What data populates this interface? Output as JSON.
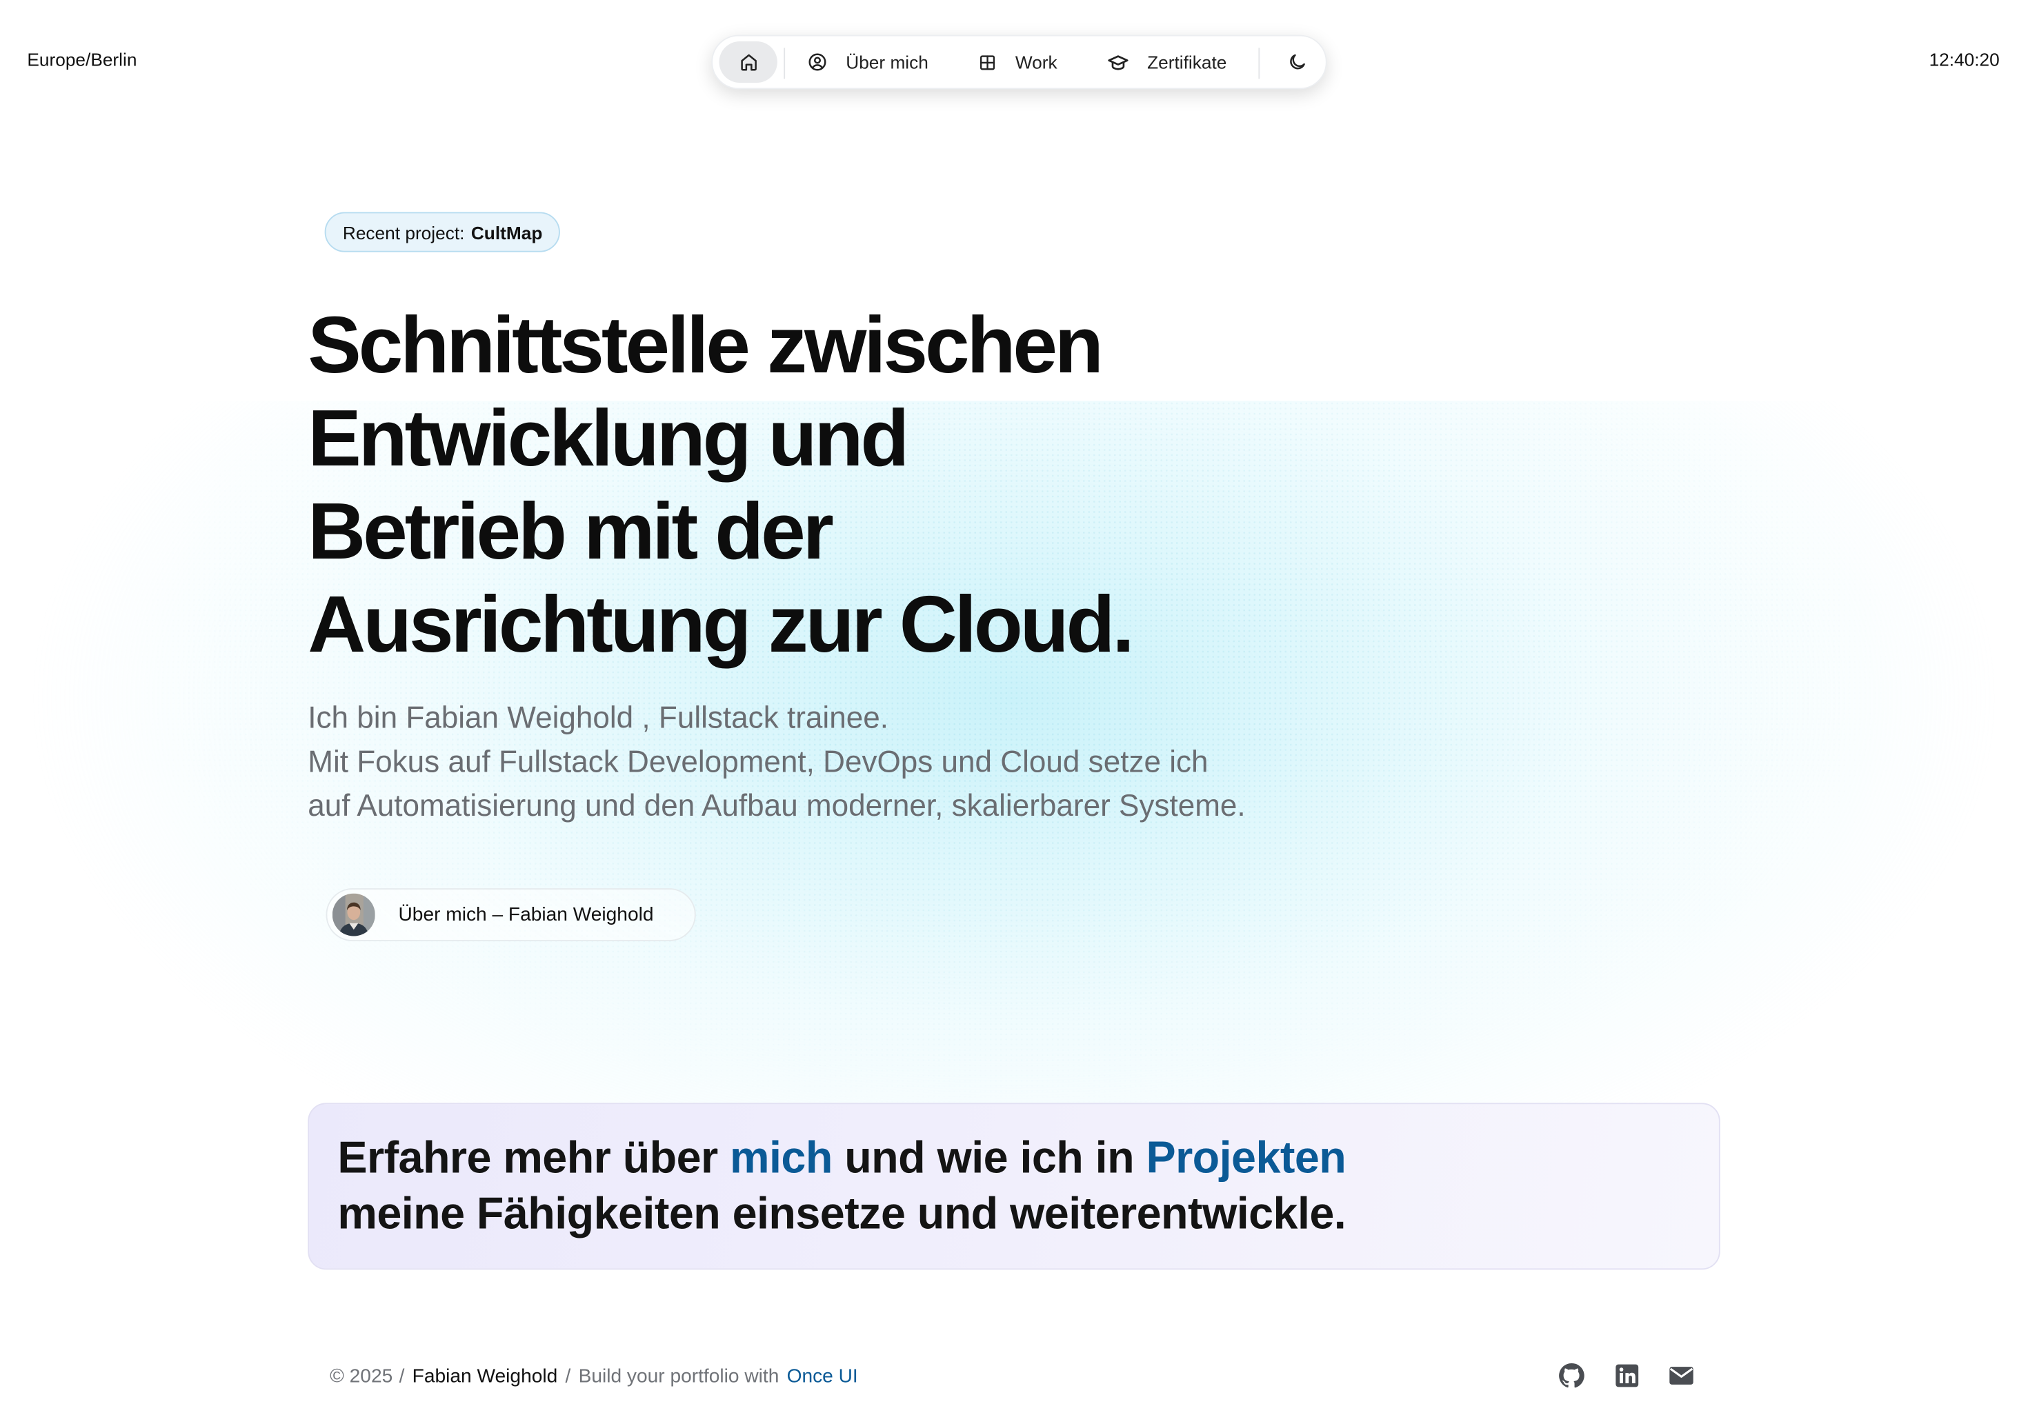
{
  "header": {
    "timezone": "Europe/Berlin",
    "clock": "12:40:20"
  },
  "nav": {
    "home_icon": "home-icon",
    "items": [
      {
        "label": "Über mich",
        "icon": "user-circle-icon"
      },
      {
        "label": "Work",
        "icon": "grid-icon"
      },
      {
        "label": "Zertifikate",
        "icon": "graduation-cap-icon"
      }
    ],
    "theme_icon": "moon-icon"
  },
  "hero": {
    "badge_prefix": "Recent project:",
    "badge_project": "CultMap",
    "headline": [
      "Schnittstelle zwischen",
      "Entwicklung und",
      "Betrieb mit der",
      "Ausrichtung zur Cloud."
    ],
    "intro": [
      "Ich bin Fabian Weighold , Fullstack trainee.",
      "Mit Fokus auf Fullstack Development, DevOps und Cloud setze ich",
      "auf Automatisierung und den Aufbau moderner, skalierbarer Systeme."
    ],
    "about_button": "Über mich – Fabian Weighold"
  },
  "cta": {
    "part1": "Erfahre mehr über",
    "link1": "mich",
    "part2": "und wie ich in",
    "link2": "Projekten",
    "line2": "meine Fähigkeiten einsetze und weiterentwickle."
  },
  "footer": {
    "copyright": "© 2025",
    "slash1": "/",
    "name": "Fabian Weighold",
    "slash2": "/",
    "build_text": "Build your portfolio with",
    "link": "Once UI",
    "social_icons": [
      "github-icon",
      "linkedin-icon",
      "email-icon"
    ]
  },
  "colors": {
    "accent_link": "#0b5a96",
    "glow": "#b9eef8",
    "cta_background": "#ebe9fb",
    "badge_background": "#e8f4fb"
  }
}
